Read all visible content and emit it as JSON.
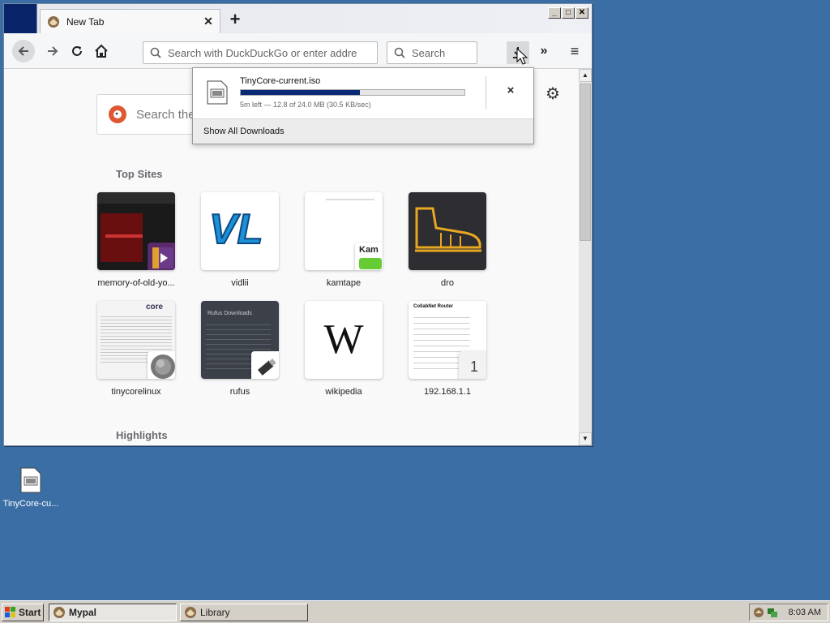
{
  "browser": {
    "tab_title": "New Tab",
    "url_placeholder": "Search with DuckDuckGo or enter addre",
    "search_placeholder": "Search",
    "overflow_label": "»",
    "menu_label": "≡"
  },
  "newtab": {
    "ddg_search_placeholder": "Search the",
    "top_sites_title": "Top Sites",
    "highlights_title": "Highlights",
    "sites": [
      {
        "label": "memory-of-old-yo..."
      },
      {
        "label": "vidlii",
        "thumb_text": "VL"
      },
      {
        "label": "kamtape",
        "thumb_text": "Kam"
      },
      {
        "label": "dro"
      },
      {
        "label": "tinycorelinux",
        "thumb_text": "core"
      },
      {
        "label": "rufus",
        "thumb_text": "Rufus Downloads"
      },
      {
        "label": "wikipedia",
        "thumb_text": "W"
      },
      {
        "label": "192.168.1.1",
        "thumb_text": "CollabNet Router",
        "badge_text": "1"
      }
    ]
  },
  "download": {
    "file_name": "TinyCore-current.iso",
    "status": "5m left — 12.8 of 24.0 MB (30.5 KB/sec)",
    "progress": 0.533,
    "cancel_label": "×",
    "show_all": "Show All Downloads"
  },
  "desktop": {
    "icon_label": "TinyCore-cu..."
  },
  "taskbar": {
    "start_label": "Start",
    "tasks": [
      {
        "label": "Mypal",
        "active": true
      },
      {
        "label": "Library",
        "active": false
      }
    ],
    "clock": "8:03 AM"
  },
  "colors": {
    "desktop": "#3a6ea5",
    "progress_fill": "#0a2a78",
    "title_block": "#0a246a"
  }
}
